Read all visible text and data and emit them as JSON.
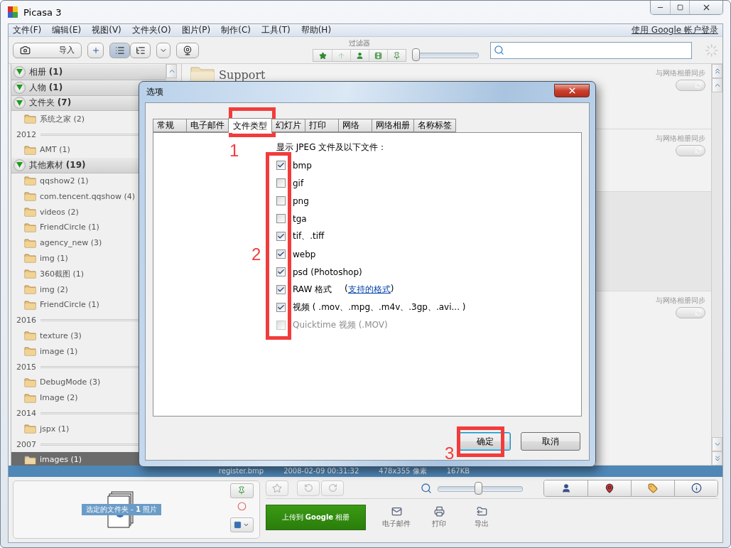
{
  "window": {
    "title": "Picasa 3"
  },
  "menu": [
    "文件(F)",
    "编辑(E)",
    "视图(V)",
    "文件夹(O)",
    "图片(P)",
    "制作(C)",
    "工具(T)",
    "帮助(H)"
  ],
  "sign_in_link": "使用 Google 帐户登录",
  "toolbar": {
    "import_label": "导入",
    "filter_label": "过滤器",
    "size_slider": {
      "level": 0
    },
    "views": [
      {
        "selected": true
      },
      {
        "selected": false
      }
    ]
  },
  "sidebar": {
    "items": [
      {
        "kind": "group",
        "label": "相册 **(1)**",
        "expanded": true
      },
      {
        "kind": "group",
        "label": "人物 **(1)**",
        "expanded": true
      },
      {
        "kind": "group",
        "label": "文件夹 **(7)**",
        "expanded": true
      },
      {
        "kind": "folder",
        "label": "系统之家 (2)",
        "selected": false
      },
      {
        "kind": "year",
        "label": "2012"
      },
      {
        "kind": "folder",
        "label": "AMT (1)",
        "selected": false
      },
      {
        "kind": "group",
        "label": "其他素材 **(19)**",
        "expanded": true
      },
      {
        "kind": "folder",
        "label": "qqshow2 (1)",
        "selected": false
      },
      {
        "kind": "folder",
        "label": "com.tencent.qqshow (4)",
        "selected": false
      },
      {
        "kind": "folder",
        "label": "videos (2)",
        "selected": false
      },
      {
        "kind": "folder",
        "label": "FriendCircle (1)",
        "selected": false
      },
      {
        "kind": "folder",
        "label": "agency_new (3)",
        "selected": false
      },
      {
        "kind": "folder",
        "label": "img (1)",
        "selected": false
      },
      {
        "kind": "folder",
        "label": "360截图 (1)",
        "selected": false
      },
      {
        "kind": "folder",
        "label": "img (2)",
        "selected": false
      },
      {
        "kind": "folder",
        "label": "FriendCircle (1)",
        "selected": false
      },
      {
        "kind": "year",
        "label": "2016"
      },
      {
        "kind": "folder",
        "label": "texture (3)",
        "selected": false
      },
      {
        "kind": "folder",
        "label": "image (1)",
        "selected": false
      },
      {
        "kind": "year",
        "label": "2015"
      },
      {
        "kind": "folder",
        "label": "DebugMode (3)",
        "selected": false
      },
      {
        "kind": "folder",
        "label": "Image (2)",
        "selected": false
      },
      {
        "kind": "year",
        "label": "2014"
      },
      {
        "kind": "folder",
        "label": "jspx (1)",
        "selected": false
      },
      {
        "kind": "year",
        "label": "2007"
      },
      {
        "kind": "folder",
        "label": "images (1)",
        "selected": true
      }
    ]
  },
  "albums": [
    {
      "title": "Support",
      "sync_label": "与网络相册同步",
      "selected": false
    },
    {
      "sync_label": "与网络相册同步",
      "selected": false
    },
    {
      "selected": true
    },
    {
      "sync_label": "与网络相册同步",
      "selected": false
    }
  ],
  "dialog": {
    "title": "选项",
    "tabs": [
      {
        "label": "常规",
        "selected": false
      },
      {
        "label": "电子邮件",
        "selected": false
      },
      {
        "label": "文件类型",
        "selected": true
      },
      {
        "label": "幻灯片",
        "selected": false
      },
      {
        "label": "打印",
        "selected": false
      },
      {
        "label": "网络",
        "selected": false
      },
      {
        "label": "网络相册",
        "selected": false
      },
      {
        "label": "名称标签",
        "selected": false
      }
    ],
    "heading": "显示 JPEG 文件及以下文件：",
    "options": [
      {
        "label": "bmp",
        "checked": true,
        "disabled": false
      },
      {
        "label": "gif",
        "checked": false,
        "disabled": false
      },
      {
        "label": "png",
        "checked": false,
        "disabled": false
      },
      {
        "label": "tga",
        "checked": false,
        "disabled": false
      },
      {
        "label": "tif、.tiff",
        "checked": true,
        "disabled": false
      },
      {
        "label": "webp",
        "checked": true,
        "disabled": false
      },
      {
        "label": "psd (Photoshop)",
        "checked": true,
        "disabled": false
      },
      {
        "label": "RAW 格式",
        "checked": true,
        "disabled": false,
        "link_before": "(",
        "link": "支持的格式",
        "link_after": ")"
      },
      {
        "label": "视频 ( .mov、.mpg、.m4v、.3gp、.avi... )",
        "checked": true,
        "disabled": false
      },
      {
        "label": "Quicktime 视频 (.MOV)",
        "checked": false,
        "disabled": true
      }
    ],
    "buttons": [
      {
        "label": "确定",
        "default": true
      },
      {
        "label": "取消",
        "default": false
      }
    ]
  },
  "annotations": [
    {
      "label": "1"
    },
    {
      "label": "2"
    },
    {
      "label": "3"
    }
  ],
  "status_bar": [
    "register.bmp",
    "2008-02-09 00:31:32",
    "478x355 像素",
    "167KB"
  ],
  "tray": {
    "label": "选定的文件夹 - **1** 照片"
  },
  "zoom_slider": {
    "level": 0.48
  },
  "upload_button": "上传到 **Google** 相册",
  "actions": [
    {
      "kind": "email",
      "label": "电子邮件"
    },
    {
      "kind": "print",
      "label": "打印"
    },
    {
      "kind": "export",
      "label": "导出"
    }
  ]
}
